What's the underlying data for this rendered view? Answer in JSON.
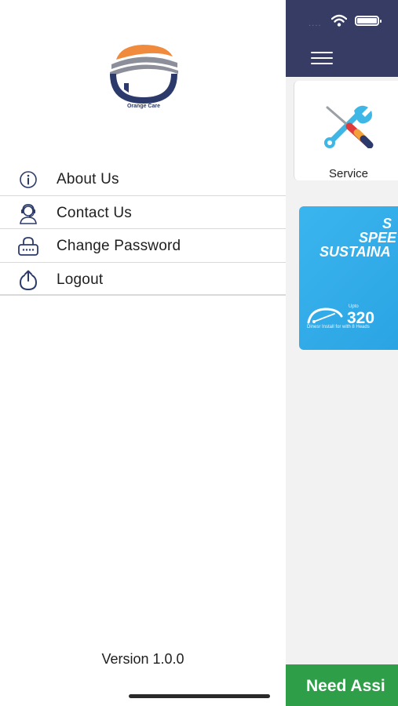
{
  "app": {
    "brand_name": "Orange Care",
    "colors": {
      "header": "#363c63",
      "brand_orange": "#f08a3c",
      "brand_navy": "#2b3a6b",
      "banner_blue": "#2ea7e8",
      "assist_green": "#2e9e48"
    }
  },
  "status_bar": {
    "signal_dots": "....",
    "icons": [
      "wifi-icon",
      "battery-icon"
    ]
  },
  "drawer": {
    "logo_caption": "Orange Care",
    "menu": [
      {
        "label": "About Us",
        "icon": "info-icon"
      },
      {
        "label": "Contact Us",
        "icon": "support-agent-icon"
      },
      {
        "label": "Change Password",
        "icon": "lock-password-icon"
      },
      {
        "label": "Logout",
        "icon": "power-icon"
      }
    ],
    "version": "Version 1.0.0"
  },
  "home": {
    "menu_icon": "hamburger-icon",
    "service_card": {
      "label": "Service",
      "icon": "tools-icon"
    },
    "banner": {
      "line1": "S",
      "line2": "SPEE",
      "line3": "SUSTAINA",
      "upto": "Upto",
      "number": "320",
      "sub": "Dinesr Install for with 8 Heads"
    },
    "assist_button": "Need Assi"
  }
}
